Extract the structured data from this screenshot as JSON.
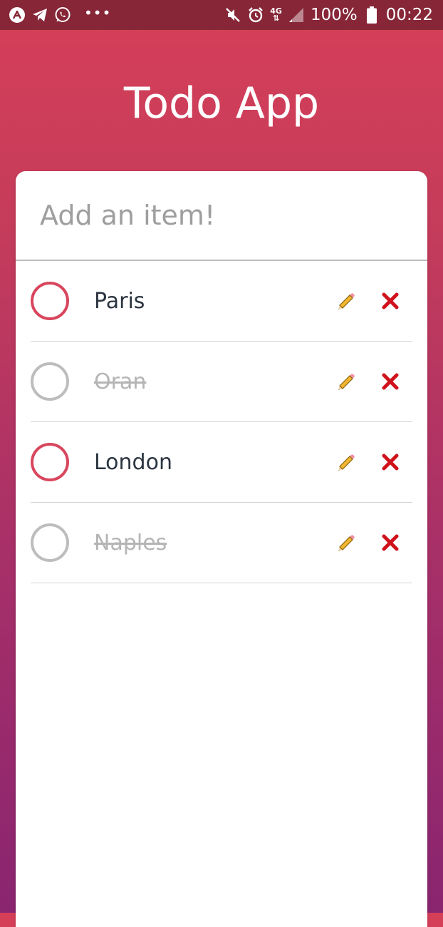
{
  "status_bar": {
    "battery": "100%",
    "time": "00:22",
    "network_top": "4G",
    "network_bottom": "⇅"
  },
  "app": {
    "title": "Todo App"
  },
  "add_input": {
    "placeholder": "Add an item!",
    "value": ""
  },
  "todos": [
    {
      "text": "Paris",
      "done": false
    },
    {
      "text": "Oran",
      "done": true
    },
    {
      "text": "London",
      "done": false
    },
    {
      "text": "Naples",
      "done": true
    }
  ],
  "icons": {
    "edit": "pencil-icon",
    "delete": "close-icon",
    "check": "circle-check"
  },
  "colors": {
    "accent": "#d8465d",
    "done_gray": "#bdbdbd",
    "delete_red": "#d0121c",
    "status_bar": "#862637"
  }
}
